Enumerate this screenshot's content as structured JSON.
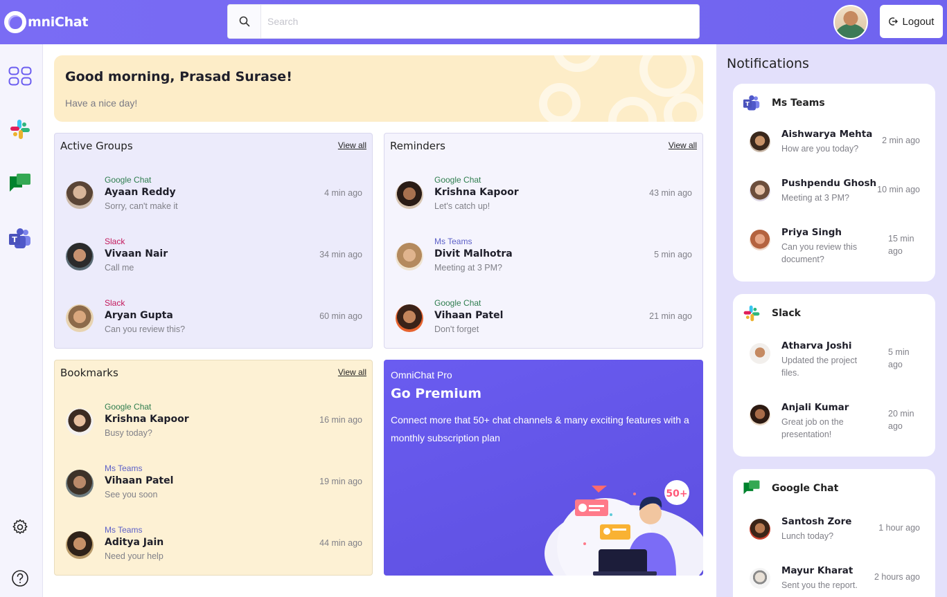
{
  "app": {
    "logo_text": "mniChat"
  },
  "header": {
    "search_placeholder": "Search",
    "logout_label": "Logout"
  },
  "sidebar": {
    "items": [
      "dashboard-icon",
      "slack-icon",
      "google-chat-icon",
      "ms-teams-icon",
      "settings-icon",
      "help-icon"
    ]
  },
  "greeting": {
    "title": "Good morning, Prasad Surase!",
    "subtitle": "Have a nice day!"
  },
  "active_groups": {
    "title": "Active Groups",
    "view_all": "View all",
    "items": [
      {
        "source": "Google Chat",
        "name": "Ayaan Reddy",
        "message": "Sorry, can't make it",
        "time": "4 min ago"
      },
      {
        "source": "Slack",
        "name": "Vivaan Nair",
        "message": "Call me",
        "time": "34 min ago"
      },
      {
        "source": "Slack",
        "name": "Aryan Gupta",
        "message": "Can you review this?",
        "time": "60 min ago"
      }
    ]
  },
  "reminders": {
    "title": "Reminders",
    "view_all": "View all",
    "items": [
      {
        "source": "Google Chat",
        "name": "Krishna Kapoor",
        "message": "Let's catch up!",
        "time": "43 min ago"
      },
      {
        "source": "Ms Teams",
        "name": "Divit Malhotra",
        "message": "Meeting at 3 PM?",
        "time": "5 min ago"
      },
      {
        "source": "Google Chat",
        "name": "Vihaan Patel",
        "message": "Don't forget",
        "time": "21 min ago"
      }
    ]
  },
  "bookmarks": {
    "title": "Bookmarks",
    "view_all": "View all",
    "items": [
      {
        "source": "Google Chat",
        "name": "Krishna Kapoor",
        "message": "Busy today?",
        "time": "16 min ago"
      },
      {
        "source": "Ms Teams",
        "name": "Vihaan Patel",
        "message": "See you soon",
        "time": "19 min ago"
      },
      {
        "source": "Ms Teams",
        "name": "Aditya Jain",
        "message": "Need your help",
        "time": "44 min ago"
      }
    ]
  },
  "promo": {
    "eyebrow": "OmniChat Pro",
    "title": "Go Premium",
    "text": "Connect more that 50+ chat channels & many exciting features with a monthly subscription plan",
    "badge": "50+"
  },
  "notifications": {
    "title": "Notifications",
    "groups": [
      {
        "app": "Ms Teams",
        "items": [
          {
            "name": "Aishwarya Mehta",
            "message": "How are you today?",
            "time": "2 min ago"
          },
          {
            "name": "Pushpendu Ghosh",
            "message": "Meeting at 3 PM?",
            "time": "10 min ago"
          },
          {
            "name": "Priya Singh",
            "message": "Can you review this document?",
            "time": "15 min ago"
          }
        ]
      },
      {
        "app": "Slack",
        "items": [
          {
            "name": "Atharva Joshi",
            "message": "Updated the project files.",
            "time": "5 min ago"
          },
          {
            "name": "Anjali Kumar",
            "message": "Great job on the presentation!",
            "time": "20 min ago"
          }
        ]
      },
      {
        "app": "Google Chat",
        "items": [
          {
            "name": "Santosh Zore",
            "message": "Lunch today?",
            "time": "1 hour ago"
          },
          {
            "name": "Mayur Kharat",
            "message": "Sent you the report.",
            "time": "2 hours ago"
          }
        ]
      }
    ]
  },
  "colors": {
    "brand": "#7367f0",
    "greeting_bg": "#fdedc8",
    "groups_bg": "#ecebfb",
    "reminders_bg": "#f5f4fd",
    "bookmarks_bg": "#fdf1d4",
    "notif_bg": "#e3e0fb",
    "gchat": "#2e7d4e",
    "slack": "#c2185b",
    "teams": "#5b5fc7"
  }
}
